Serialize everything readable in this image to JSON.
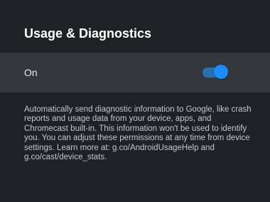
{
  "header": {
    "title": "Usage & Diagnostics"
  },
  "setting": {
    "label": "On",
    "toggle_state": "on",
    "toggle_color": "#1a8cff"
  },
  "description": {
    "text": "Automatically send diagnostic information to Google, like crash reports and usage data from your device, apps, and Chromecast built-in. This information won't be used to identify you. You can adjust these permissions at any time from device settings. Learn more at: g.co/AndroidUsageHelp and g.co/cast/device_stats."
  }
}
